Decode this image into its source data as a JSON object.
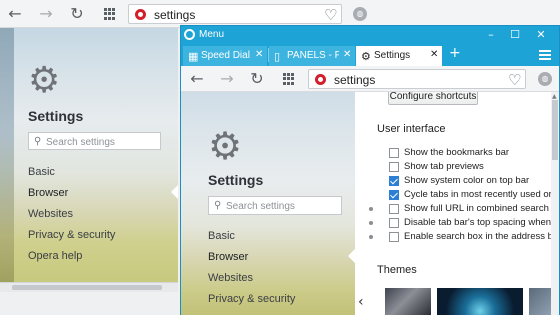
{
  "back_window": {
    "address": {
      "text": "settings"
    },
    "sidebar": {
      "title": "Settings",
      "search_placeholder": "Search settings",
      "items": [
        {
          "label": "Basic"
        },
        {
          "label": "Browser"
        },
        {
          "label": "Websites"
        },
        {
          "label": "Privacy & security"
        },
        {
          "label": "Opera help"
        }
      ],
      "active_index": 1
    }
  },
  "front_window": {
    "titlebar": {
      "menu_label": "Menu"
    },
    "tabs": [
      {
        "icon": "speed-dial-icon",
        "label": "Speed Dial",
        "active": false
      },
      {
        "icon": "page-icon",
        "label": "PANELS - File",
        "active": false
      },
      {
        "icon": "gear-icon",
        "label": "Settings",
        "active": true
      }
    ],
    "address": {
      "text": "settings"
    },
    "sidebar": {
      "title": "Settings",
      "search_placeholder": "Search settings",
      "items": [
        {
          "label": "Basic"
        },
        {
          "label": "Browser"
        },
        {
          "label": "Websites"
        },
        {
          "label": "Privacy & security"
        }
      ],
      "active_index": 1
    },
    "main": {
      "shortcuts_button": "Configure shortcuts",
      "ui_section": {
        "heading": "User interface",
        "options": [
          {
            "label": "Show the bookmarks bar",
            "checked": false,
            "bullet": false
          },
          {
            "label": "Show tab previews",
            "checked": false,
            "bullet": false
          },
          {
            "label": "Show system color on top bar",
            "checked": true,
            "bullet": false
          },
          {
            "label": "Cycle tabs in most recently used order",
            "checked": true,
            "bullet": false
          },
          {
            "label": "Show full URL in combined search and a",
            "checked": false,
            "bullet": true
          },
          {
            "label": "Disable tab bar's top spacing when brov",
            "checked": false,
            "bullet": true
          },
          {
            "label": "Enable search box in the address bar",
            "checked": false,
            "bullet": true
          }
        ]
      },
      "themes": {
        "heading": "Themes"
      }
    }
  },
  "colors": {
    "opera_red": "#d21f2a",
    "accent_blue": "#1da3d6",
    "checkbox_blue": "#2d7fd3"
  }
}
